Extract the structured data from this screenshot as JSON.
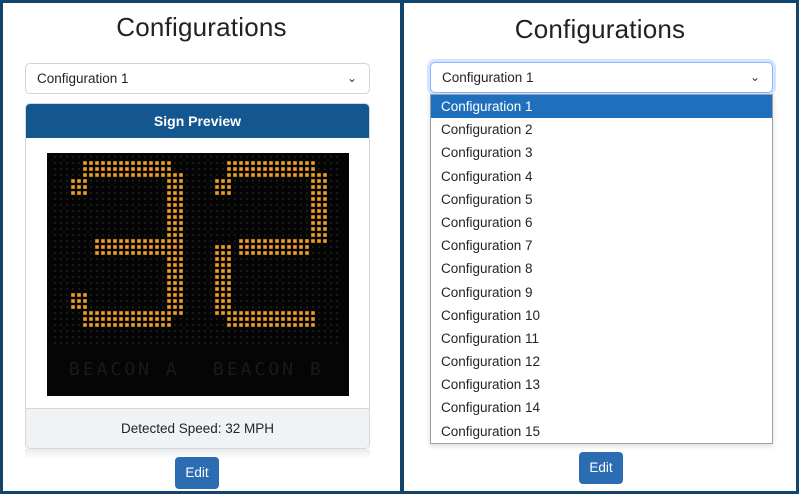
{
  "left_panel": {
    "title": "Configurations",
    "select_value": "Configuration 1",
    "preview_header": "Sign Preview",
    "sign_digits": "32",
    "beacon_labels": [
      "BEACON A",
      "BEACON B"
    ],
    "detected_speed": "Detected Speed: 32 MPH",
    "edit_label": "Edit"
  },
  "right_panel": {
    "title": "Configurations",
    "select_value": "Configuration 1",
    "options": [
      "Configuration 1",
      "Configuration 2",
      "Configuration 3",
      "Configuration 4",
      "Configuration 5",
      "Configuration 6",
      "Configuration 7",
      "Configuration 8",
      "Configuration 9",
      "Configuration 10",
      "Configuration 11",
      "Configuration 12",
      "Configuration 13",
      "Configuration 14",
      "Configuration 15"
    ],
    "selected_option": "Configuration 1",
    "edit_label": "Edit"
  },
  "colors": {
    "header_blue": "#14568f",
    "button_blue": "#2b6cb3",
    "led_on": "#f0a020",
    "led_off": "#222222",
    "frame": "#13446b"
  }
}
